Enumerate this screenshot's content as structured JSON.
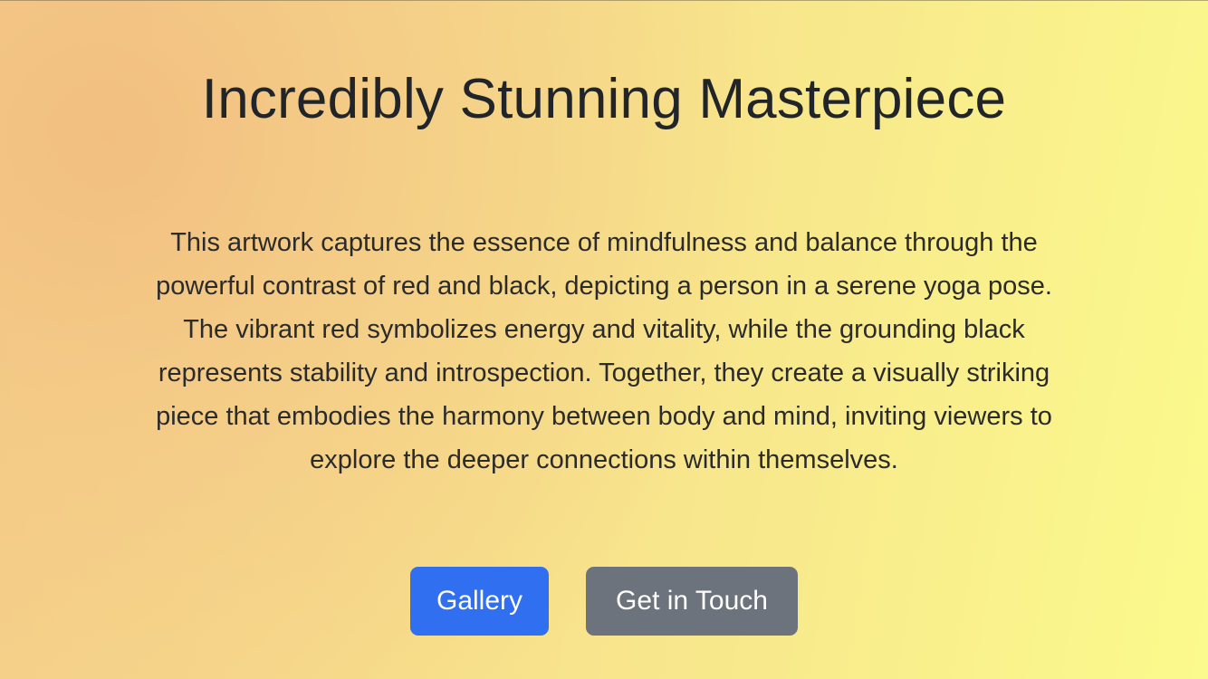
{
  "hero": {
    "title": "Incredibly Stunning Masterpiece",
    "description": "This artwork captures the essence of mindfulness and balance through the powerful contrast of red and black, depicting a person in a serene yoga pose. The vibrant red symbolizes energy and vitality, while the grounding black represents stability and introspection. Together, they create a visually striking piece that embodies the harmony between body and mind, inviting viewers to explore the deeper connections within themselves."
  },
  "actions": {
    "primary_label": "Gallery",
    "secondary_label": "Get in Touch"
  },
  "colors": {
    "primary_button": "#2f6ff0",
    "secondary_button": "#6c737d",
    "background_start": "#f3c685",
    "background_end": "#fbfa8c",
    "text": "#212529"
  }
}
